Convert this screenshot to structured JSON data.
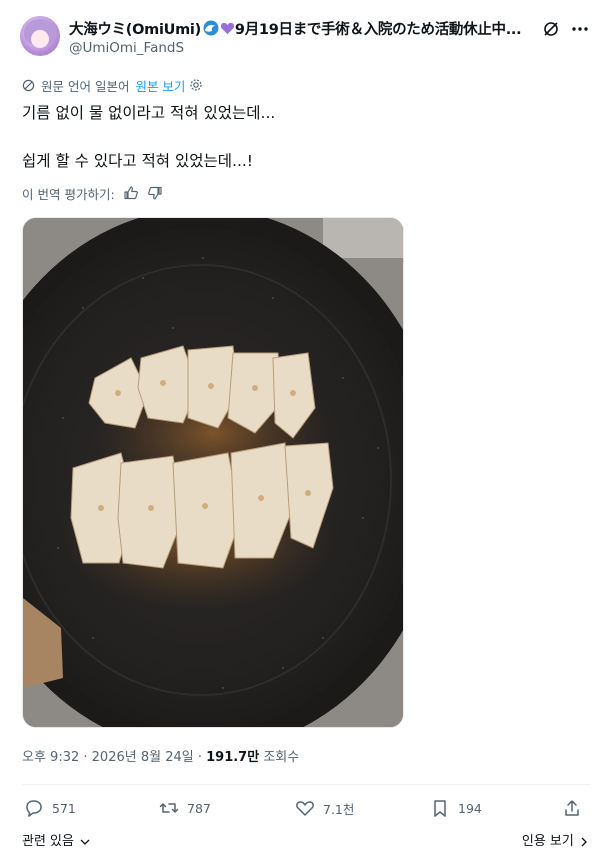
{
  "author": {
    "display_name": "大海ウミ(OmiUmi)",
    "status_text": "9月19日まで手術＆入院のため活動休止中...",
    "handle": "@UmiOmi_FandS",
    "avatar_icon": "avatar-anime-girl",
    "wave_icon": "wave-icon",
    "heart_color": "#9b6fd6"
  },
  "translation": {
    "note": "원문 언어 일본어",
    "show_original": "원본 보기"
  },
  "post": {
    "line1": "기름 없이 물 없이라고 적혀 있었는데...",
    "line2": "쉽게 할 수 있다고 적혀 있었는데...!"
  },
  "rate_translation": "이 번역 평가하기:",
  "media": {
    "description_icon": "photo-gyoza-frying-pan"
  },
  "meta": {
    "time": "오후 9:32",
    "separator": " · ",
    "date": "2026년 8월 24일",
    "views_count": "191.7만",
    "views_label": "조회수"
  },
  "actions": {
    "replies": "571",
    "reposts": "787",
    "likes": "7.1천",
    "bookmarks": "194"
  },
  "footer": {
    "related": "관련 있음",
    "quote_view": "인용 보기"
  },
  "colors": {
    "accent": "#1d9bf0",
    "text_secondary": "#536471"
  }
}
